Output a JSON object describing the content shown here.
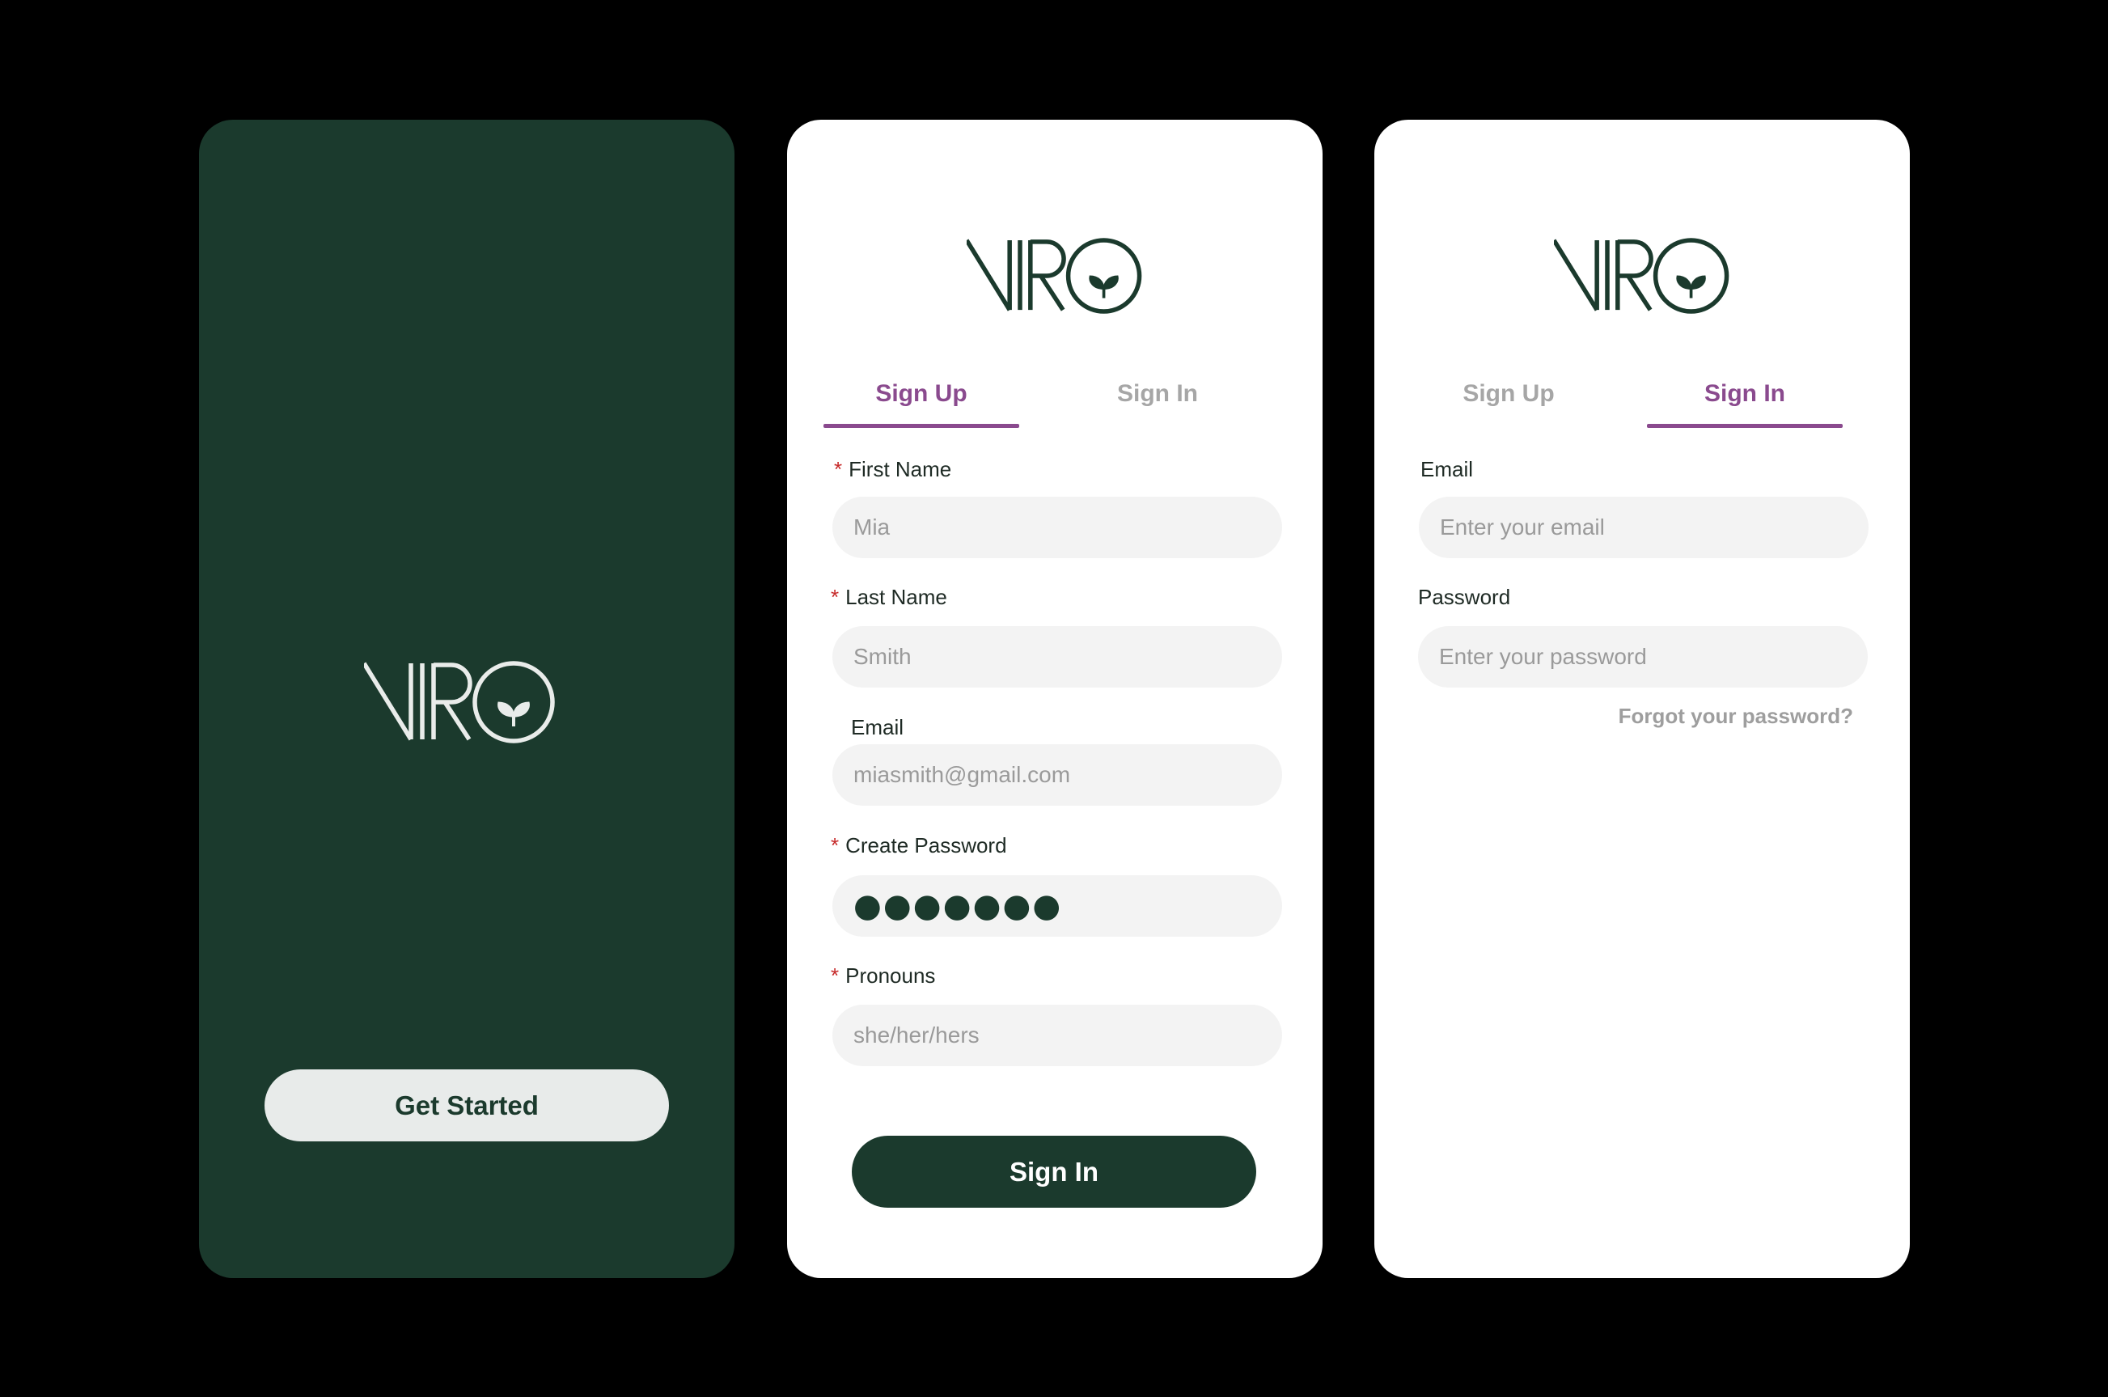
{
  "brand": {
    "name": "VIRO",
    "dark_green": "#1b3a2d",
    "accent_purple": "#8a4a8e",
    "field_bg": "#f3f3f3"
  },
  "splash": {
    "get_started_label": "Get Started"
  },
  "signup": {
    "tabs": {
      "sign_up": "Sign Up",
      "sign_in": "Sign In"
    },
    "required_mark": "*",
    "fields": {
      "first_name": {
        "label": "First Name",
        "value": "Mia"
      },
      "last_name": {
        "label": "Last Name",
        "value": "Smith"
      },
      "email": {
        "label": "Email",
        "value": "miasmith@gmail.com"
      },
      "password": {
        "label": "Create Password",
        "masked_value": "●●●●●●●"
      },
      "pronouns": {
        "label": "Pronouns",
        "value": "she/her/hers"
      }
    },
    "submit_label": "Sign In"
  },
  "signin": {
    "tabs": {
      "sign_up": "Sign Up",
      "sign_in": "Sign In"
    },
    "fields": {
      "email": {
        "label": "Email",
        "placeholder": "Enter your email"
      },
      "password": {
        "label": "Password",
        "placeholder": "Enter your password"
      }
    },
    "forgot_label": "Forgot your password?"
  }
}
